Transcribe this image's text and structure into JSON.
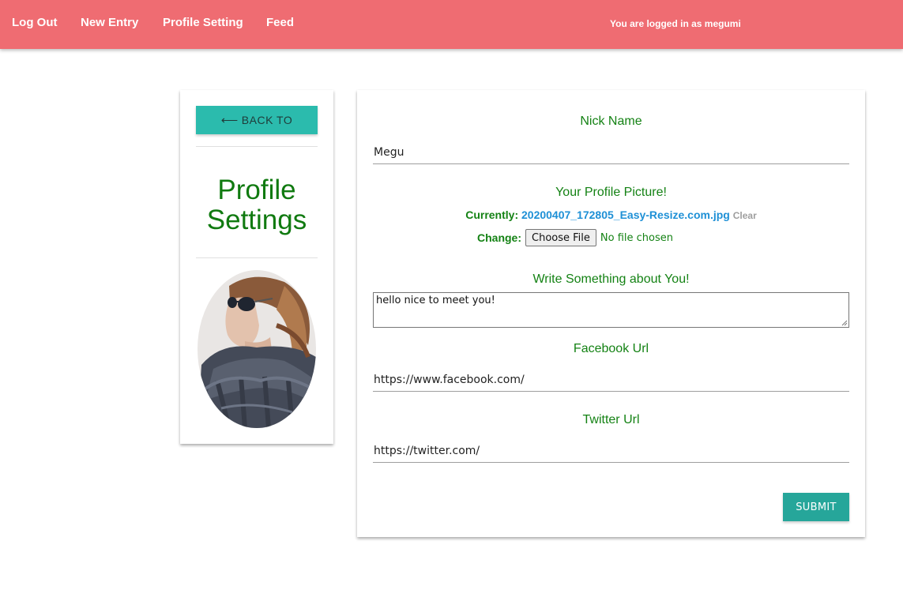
{
  "navbar": {
    "links": [
      "Log Out",
      "New Entry",
      "Profile Setting",
      "Feed"
    ],
    "status": "You are logged in as megumi",
    "background": "#ef6c72"
  },
  "sidebar": {
    "back_label": "BACK TO",
    "back_icon": "left-arrow-icon",
    "title_line1": "Profile",
    "title_line2": "Settings"
  },
  "form": {
    "nickname_label": "Nick Name",
    "nickname_value": "Megu",
    "picture_label": "Your Profile Picture!",
    "currently_label": "Currently:",
    "current_file": "20200407_172805_Easy-Resize.com.jpg",
    "clear_label": "Clear",
    "change_label": "Change:",
    "choose_file_label": "Choose File",
    "no_file_text": "No file chosen",
    "about_label": "Write Something about You!",
    "about_value": "hello nice to meet you!",
    "facebook_label": "Facebook Url",
    "facebook_value": "https://www.facebook.com/",
    "twitter_label": "Twitter Url",
    "twitter_value": "https://twitter.com/",
    "submit_label": "SUBMIT"
  },
  "colors": {
    "accent": "#26a69a",
    "label_green": "#148214",
    "link_blue": "#1e90d6"
  }
}
